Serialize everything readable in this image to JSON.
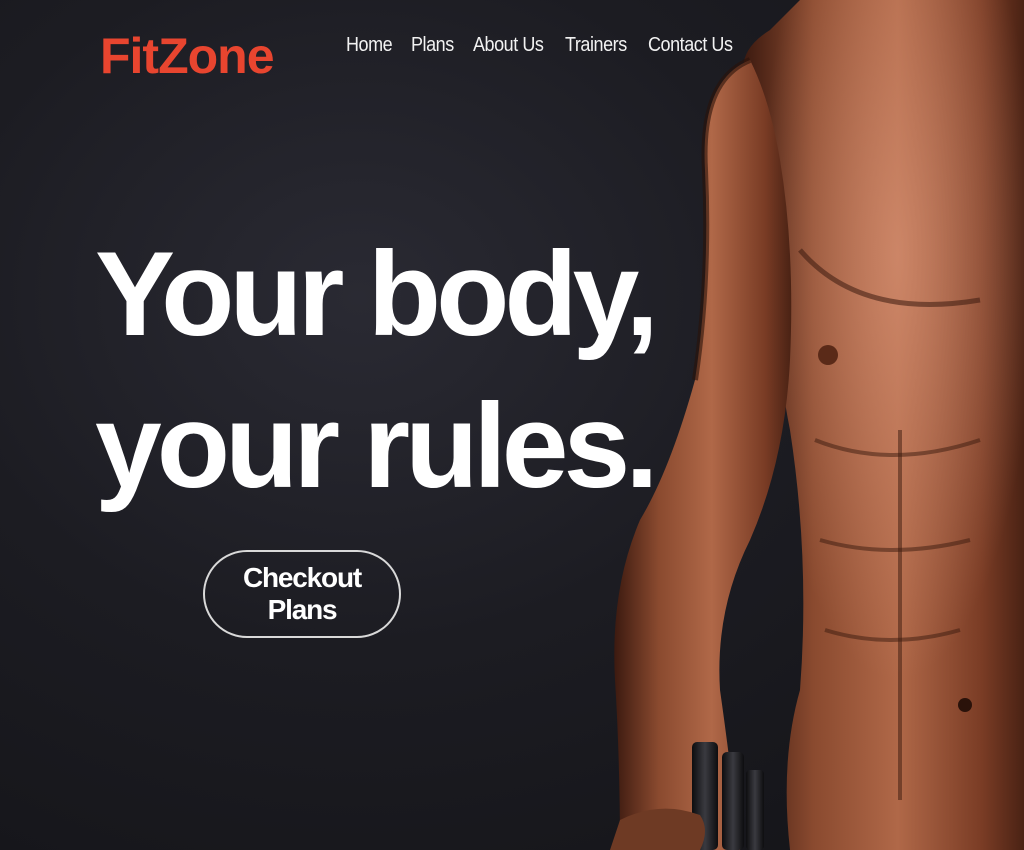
{
  "brand": {
    "name": "FitZone",
    "color": "#e8452f"
  },
  "nav": {
    "items": [
      "Home",
      "Plans",
      "About Us",
      "Trainers",
      "Contact Us"
    ]
  },
  "hero": {
    "line1": "Your body,",
    "line2": "your rules.",
    "cta_label": "Checkout Plans"
  },
  "hero_image": {
    "icon": "athlete-with-dumbbells"
  }
}
